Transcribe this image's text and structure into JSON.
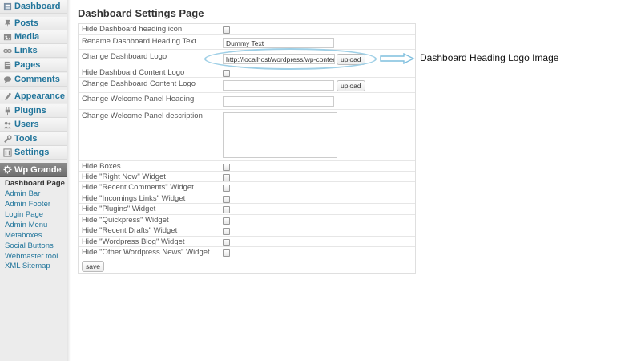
{
  "sidebar": {
    "items": [
      {
        "label": "Dashboard",
        "icon": "dashboard-icon"
      },
      {
        "label": "Posts",
        "icon": "pin-icon"
      },
      {
        "label": "Media",
        "icon": "media-icon"
      },
      {
        "label": "Links",
        "icon": "link-icon"
      },
      {
        "label": "Pages",
        "icon": "page-icon"
      },
      {
        "label": "Comments",
        "icon": "comment-icon"
      },
      {
        "label": "Appearance",
        "icon": "appearance-icon"
      },
      {
        "label": "Plugins",
        "icon": "plugin-icon"
      },
      {
        "label": "Users",
        "icon": "users-icon"
      },
      {
        "label": "Tools",
        "icon": "tools-icon"
      },
      {
        "label": "Settings",
        "icon": "settings-icon"
      },
      {
        "label": "Wp Grande",
        "icon": "gear-icon"
      }
    ],
    "submenu": [
      "Dashboard Page",
      "Admin Bar",
      "Admin Footer",
      "Login Page",
      "Admin Menu",
      "Metaboxes",
      "Social Buttons",
      "Webmaster tool",
      "XML Sitemap"
    ]
  },
  "main": {
    "title": "Dashboard Settings Page",
    "rows": {
      "hide_heading_icon": "Hide Dashboard heading icon",
      "rename_heading": "Rename Dashboard Heading Text",
      "change_logo": "Change Dashboard Logo",
      "hide_content_logo": "Hide Dashboard Content Logo",
      "change_content_logo": "Change Dashboard Content Logo",
      "welcome_heading": "Change Welcome Panel Heading",
      "welcome_description": "Change Welcome Panel description",
      "hide_boxes": "Hide Boxes",
      "hide_right_now": "Hide \"Right Now\" Widget",
      "hide_recent_comments": "Hide \"Recent Comments\" Widget",
      "hide_incoming_links": "Hide \"Incomings Links\" Widget",
      "hide_plugins": "Hide \"Plugins\" Widget",
      "hide_quickpress": "Hide \"Quickpress\" Widget",
      "hide_recent_drafts": "Hide \"Recent Drafts\" Widget",
      "hide_wordpress_blog": "Hide \"Wordpress Blog\" Widget",
      "hide_other_news": "Hide \"Other Wordpress News\" Widget"
    },
    "values": {
      "heading_text": "Dummy Text",
      "logo_url": "http://localhost/wordpress/wp-content/uplc",
      "content_logo_url": "",
      "welcome_heading": "",
      "welcome_description": ""
    },
    "buttons": {
      "upload": "upload",
      "save": "save"
    }
  },
  "annotation": {
    "label": "Dashboard Heading Logo Image",
    "color": "#9ecfe6"
  },
  "colors": {
    "link": "#21759b",
    "active_menu": "#7a7a7a"
  }
}
